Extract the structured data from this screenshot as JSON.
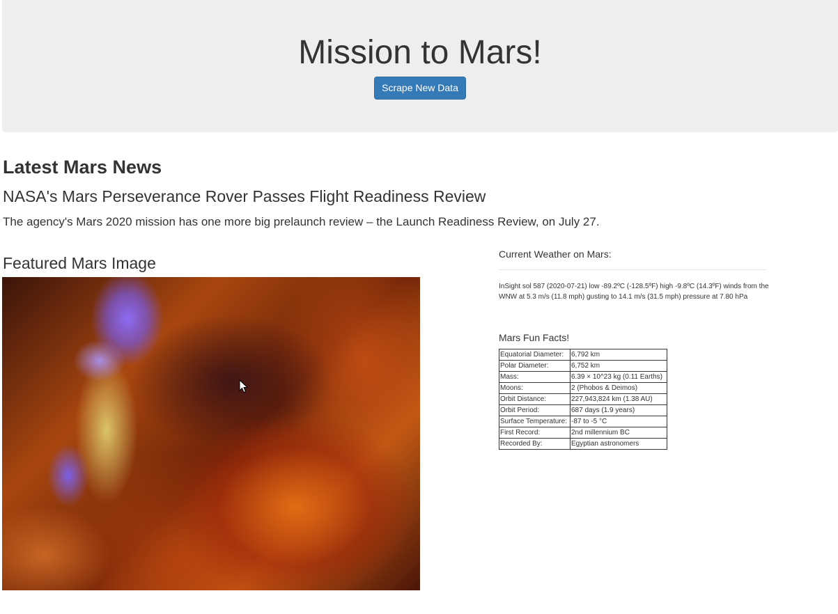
{
  "header": {
    "title": "Mission to Mars!",
    "scrape_button_label": "Scrape New Data"
  },
  "news": {
    "section_heading": "Latest Mars News",
    "title": "NASA's Mars Perseverance Rover Passes Flight Readiness Review",
    "teaser": "The agency's Mars 2020 mission has one more big prelaunch review – the Launch Readiness Review, on July 27."
  },
  "featured": {
    "heading": "Featured Mars Image"
  },
  "weather": {
    "label": "Current Weather on Mars:",
    "text": "InSight sol 587 (2020-07-21) low -89.2ºC (-128.5ºF) high -9.8ºC (14.3ºF) winds from the WNW at 5.3 m/s (11.8 mph) gusting to 14.1 m/s (31.5 mph) pressure at 7.80 hPa"
  },
  "facts": {
    "label": "Mars Fun Facts!",
    "rows": [
      {
        "key": "Equatorial Diameter:",
        "value": "6,792 km"
      },
      {
        "key": "Polar Diameter:",
        "value": "6,752 km"
      },
      {
        "key": "Mass:",
        "value": "6.39 × 10^23 kg (0.11 Earths)"
      },
      {
        "key": "Moons:",
        "value": "2 (Phobos & Deimos)"
      },
      {
        "key": "Orbit Distance:",
        "value": "227,943,824 km (1.38 AU)"
      },
      {
        "key": "Orbit Period:",
        "value": "687 days (1.9 years)"
      },
      {
        "key": "Surface Temperature:",
        "value": "-87 to -5 °C"
      },
      {
        "key": "First Record:",
        "value": "2nd millennium BC"
      },
      {
        "key": "Recorded By:",
        "value": "Egyptian astronomers"
      }
    ]
  },
  "colors": {
    "jumbotron_bg": "#eeeeee",
    "button_primary": "#337ab7",
    "text": "#333333"
  }
}
